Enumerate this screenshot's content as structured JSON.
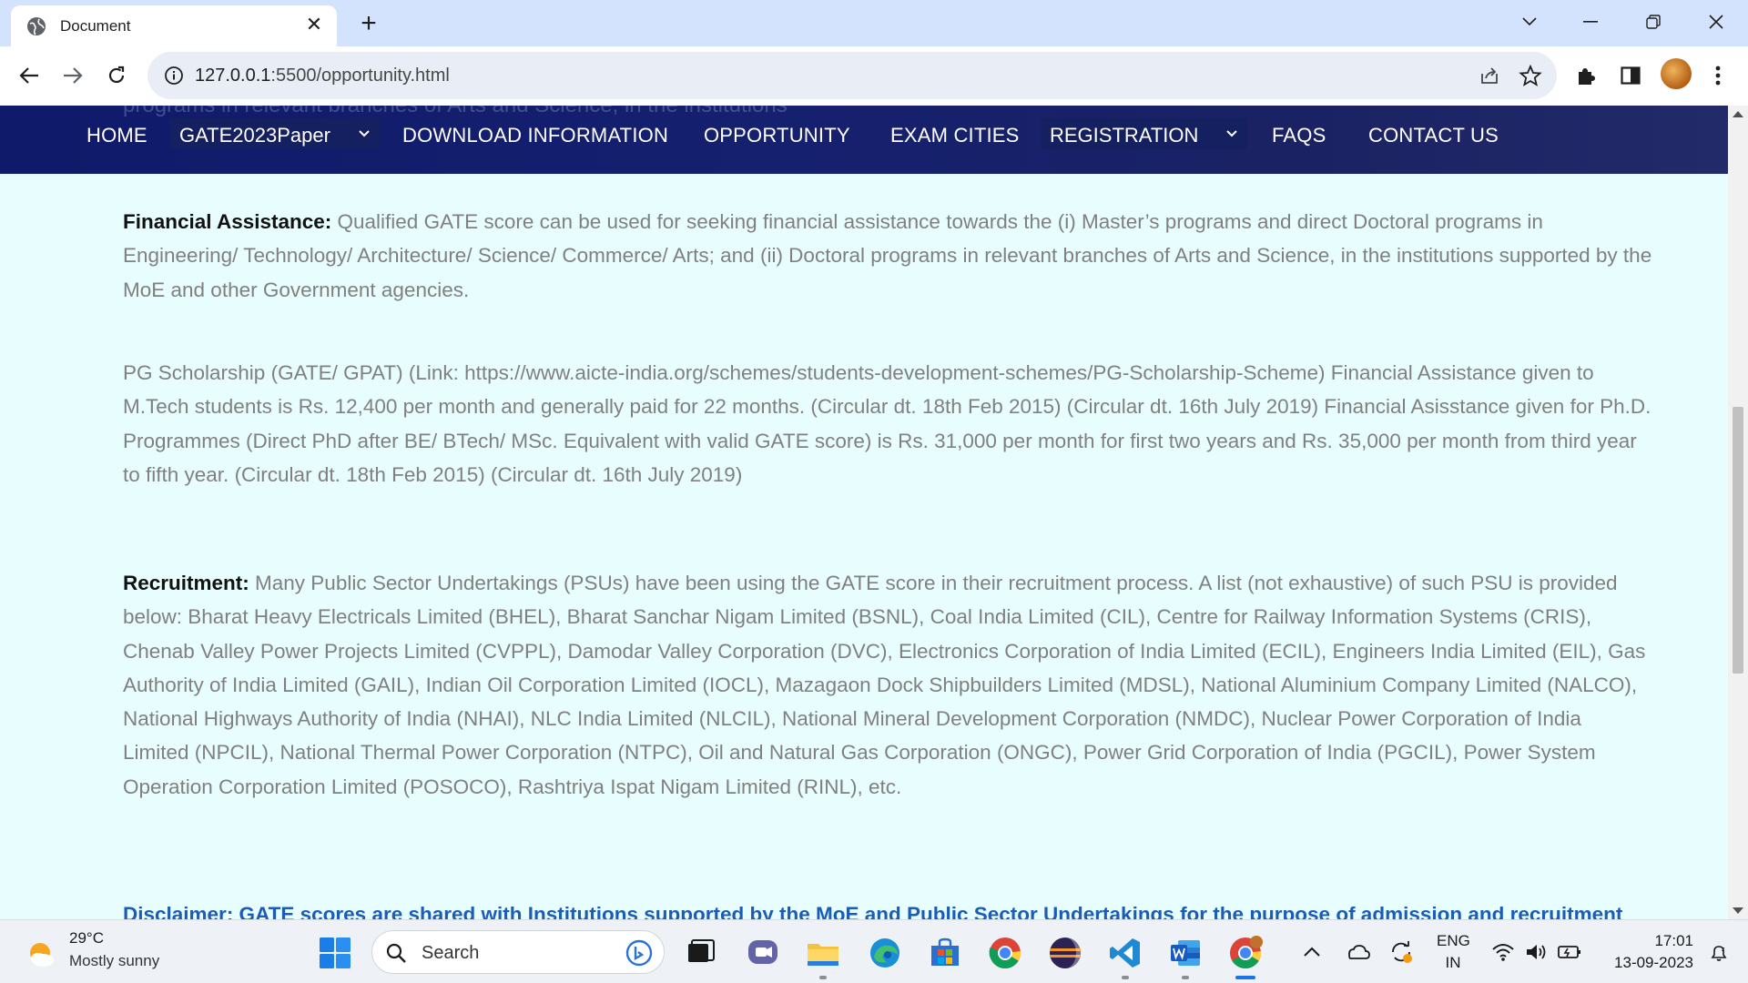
{
  "browser": {
    "tab_title": "Document",
    "url_host": "127.0.0.1",
    "url_path": ":5500/opportunity.html"
  },
  "site_nav": {
    "items": [
      "HOME",
      "GATE2023Paper",
      "DOWNLOAD INFORMATION",
      "OPPORTUNITY",
      "EXAM CITIES",
      "REGISTRATION",
      "FAQS",
      "CONTACT US"
    ]
  },
  "ghost_text": "programs in relevant branches of Arts and Science, in the institutions",
  "sections": {
    "financial": {
      "heading": "Financial Assistance:",
      "body": " Qualified GATE score can be used for seeking financial assistance towards the (i) Master’s programs and direct Doctoral programs in Engineering/ Technology/ Architecture/ Science/ Commerce/ Arts; and (ii) Doctoral programs in relevant branches of Arts and Science, in the institutions supported by the MoE and other Government agencies."
    },
    "scholarship": {
      "body": "PG Scholarship (GATE/ GPAT) (Link: https://www.aicte-india.org/schemes/students-development-schemes/PG-Scholarship-Scheme) Financial Assistance given to M.Tech students is Rs. 12,400 per month and generally paid for 22 months. (Circular dt. 18th Feb 2015) (Circular dt. 16th July 2019) Financial Asisstance given for Ph.D. Programmes (Direct PhD after BE/ BTech/ MSc. Equivalent with valid GATE score) is Rs. 31,000 per month for first two years and Rs. 35,000 per month from third year to fifth year. (Circular dt. 18th Feb 2015) (Circular dt. 16th July 2019)"
    },
    "recruitment": {
      "heading": "Recruitment:",
      "body": " Many Public Sector Undertakings (PSUs) have been using the GATE score in their recruitment process. A list (not exhaustive) of such PSU is provided below: Bharat Heavy Electricals Limited (BHEL), Bharat Sanchar Nigam Limited (BSNL), Coal India Limited (CIL), Centre for Railway Information Systems (CRIS), Chenab Valley Power Projects Limited (CVPPL), Damodar Valley Corporation (DVC), Electronics Corporation of India Limited (ECIL), Engineers India Limited (EIL), Gas Authority of India Limited (GAIL), Indian Oil Corporation Limited (IOCL), Mazagaon Dock Shipbuilders Limited (MDSL), National Aluminium Company Limited (NALCO), National Highways Authority of India (NHAI), NLC India Limited (NLCIL), National Mineral Development Corporation (NMDC), Nuclear Power Corporation of India Limited (NPCIL), National Thermal Power Corporation (NTPC), Oil and Natural Gas Corporation (ONGC), Power Grid Corporation of India (PGCIL), Power System Operation Corporation Limited (POSOCO), Rashtriya Ispat Nigam Limited (RINL), etc."
    },
    "disclaimer": "Disclaimer: GATE scores are shared with Institutions supported by the MoE and Public Sector Undertakings for the purpose of admission and recruitment"
  },
  "taskbar": {
    "weather_temp": "29°C",
    "weather_desc": "Mostly sunny",
    "search_placeholder": "Search",
    "lang_line1": "ENG",
    "lang_line2": "IN",
    "time": "17:01",
    "date": "13-09-2023"
  },
  "colors": {
    "nav_bg": "#15206f",
    "page_bg": "#e8fdfe",
    "body_text": "#808080",
    "link_blue": "#1b5cb8"
  }
}
